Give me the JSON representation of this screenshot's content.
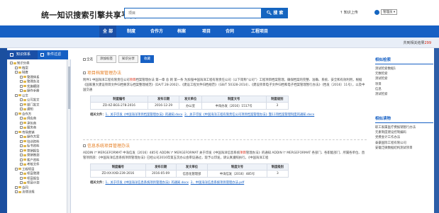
{
  "header": {
    "logo": "统一知识搜索引擎共享平台",
    "search_value": "项目",
    "search_button": "搜 索",
    "upload": "知识上传",
    "user_select": "管理员"
  },
  "nav": [
    "全 部",
    "制度",
    "合作方",
    "档案",
    "项目",
    "合同",
    "工程项目"
  ],
  "subbar": {
    "prefix": "共到相关结果",
    "count": "299"
  },
  "left_tabs": [
    "知识体系",
    "条件过滤"
  ],
  "tree": [
    {
      "label": "知识分类",
      "level": 0
    },
    {
      "label": "档案",
      "level": 1
    },
    {
      "label": "制度",
      "level": 1
    },
    {
      "label": "管理体系",
      "level": 2
    },
    {
      "label": "管理办法",
      "level": 2
    },
    {
      "label": "实施细则",
      "level": 2
    },
    {
      "label": "操作手册",
      "level": 2
    },
    {
      "label": "公文",
      "level": 1
    },
    {
      "label": "公司发文",
      "level": 2
    },
    {
      "label": "部门发文",
      "level": 2
    },
    {
      "label": "通知",
      "level": 2
    },
    {
      "label": "合作方",
      "level": 1
    },
    {
      "label": "供应商",
      "level": 2
    },
    {
      "label": "承包商",
      "level": 2
    },
    {
      "label": "服务商",
      "level": 2
    },
    {
      "label": "市场营销",
      "level": 1
    },
    {
      "label": "操作方案",
      "level": 2
    },
    {
      "label": "培训资料",
      "level": 2
    },
    {
      "label": "标书资料",
      "level": 2
    },
    {
      "label": "营销报告",
      "level": 2
    },
    {
      "label": "营销策划",
      "level": 2
    },
    {
      "label": "客户资料",
      "level": 2
    },
    {
      "label": "考核文件",
      "level": 2
    },
    {
      "label": "工程项目",
      "level": 1
    },
    {
      "label": "项目管理",
      "level": 2
    },
    {
      "label": "项目报告",
      "level": 2
    },
    {
      "label": "项目计划",
      "level": 2
    },
    {
      "label": "合同",
      "level": 1
    },
    {
      "label": "法律法规",
      "level": 1
    }
  ],
  "actions": {
    "check_all": "全选",
    "btn1": "添加标签",
    "btn2": "知识分享",
    "btn3": "收藏"
  },
  "results": [
    {
      "title": "项目档案管理办法",
      "desc_parts": [
        {
          "t": "附件1 中国海洋工程有限责任公司",
          "hl": false
        },
        {
          "t": "项目",
          "hl": true
        },
        {
          "t": "档案管理办法 第一章 总 则 第一条 为加强中国海洋工程有限责任公司（以下简称“公司”）工程项目档案管理，确保档案的完整、准确、系统、安全和有效利用，根据《国家重大建设项目文件归档要求与档案整理规范》（DA/T 28-2002）、《建设工程文件归档规范》（GB/T 50328-2014）、《建设项目电子文件归档和电子档案管理暂行办法》（档发〔2016〕11号），以及中国交通",
          "hl": false
        }
      ],
      "table_headers": [
        "制度编号",
        "发布日期",
        "发文单位",
        "制度文号",
        "制度级别"
      ],
      "table_row": [
        "ZD-XZ-BGS-278-2016",
        "2016-12-29",
        "办公室",
        "中海办发〔2016〕1517号",
        "3"
      ],
      "attach_label": "相关文件：",
      "attachments": [
        "1、关于印发《中国海洋项目档案管理办法》的通知.docx",
        "2、关于印发《中国海洋工程有限责任公司项目档案管理办法》暨11项档案管理制度的通知.docx"
      ]
    },
    {
      "title": "信息系统项目管理办法",
      "desc_parts": [
        {
          "t": "ADDIN \\* MERGEFORMAT 中海信发〔2016〕485号 ADDIN \\* MERGEFORMAT 关于印发《中国海洋信息系统",
          "hl": false
        },
        {
          "t": "项目",
          "hl": true
        },
        {
          "t": "管理办法》的通知 ADDIN \\* MERGEFORMAT 各部门、各职能部门、所属各单位、直管项目部：《中国海洋信息系统项目管理办法》已经公司2016年第五次办公会审议通过，现予以印发，请认真遵照执行。《中国海洋工程",
          "hl": false
        }
      ],
      "table_headers": [
        "制度编号",
        "发布日期",
        "发文单位",
        "制度文号",
        "制度级别"
      ],
      "table_row": [
        "ZD-XX-XXB-239-2016",
        "2016-05-09",
        "信息化管理部",
        "中海信发〔2016〕485号",
        "3"
      ],
      "attach_label": "相关文件：",
      "attachments": [
        "1、关于印发《中国海洋信息系统项目管理办法》的通知.docx",
        "2、中国海洋信息系统项目管理办法.pdf"
      ]
    }
  ],
  "right": {
    "box1": {
      "title": "相似检索",
      "links": [
        "测试检索数据1",
        "元数检索",
        "测试检索",
        "项目",
        "信息",
        "测试检索"
      ]
    },
    "box2": {
      "title": "相似读物",
      "links": [
        "职工家属医疗费报销暂行办法",
        "元素制度建设控制编码",
        "党费会计工作办法",
        "泰豪国际工程有限公司",
        "安徽泛微数据结构测试项目"
      ]
    }
  }
}
